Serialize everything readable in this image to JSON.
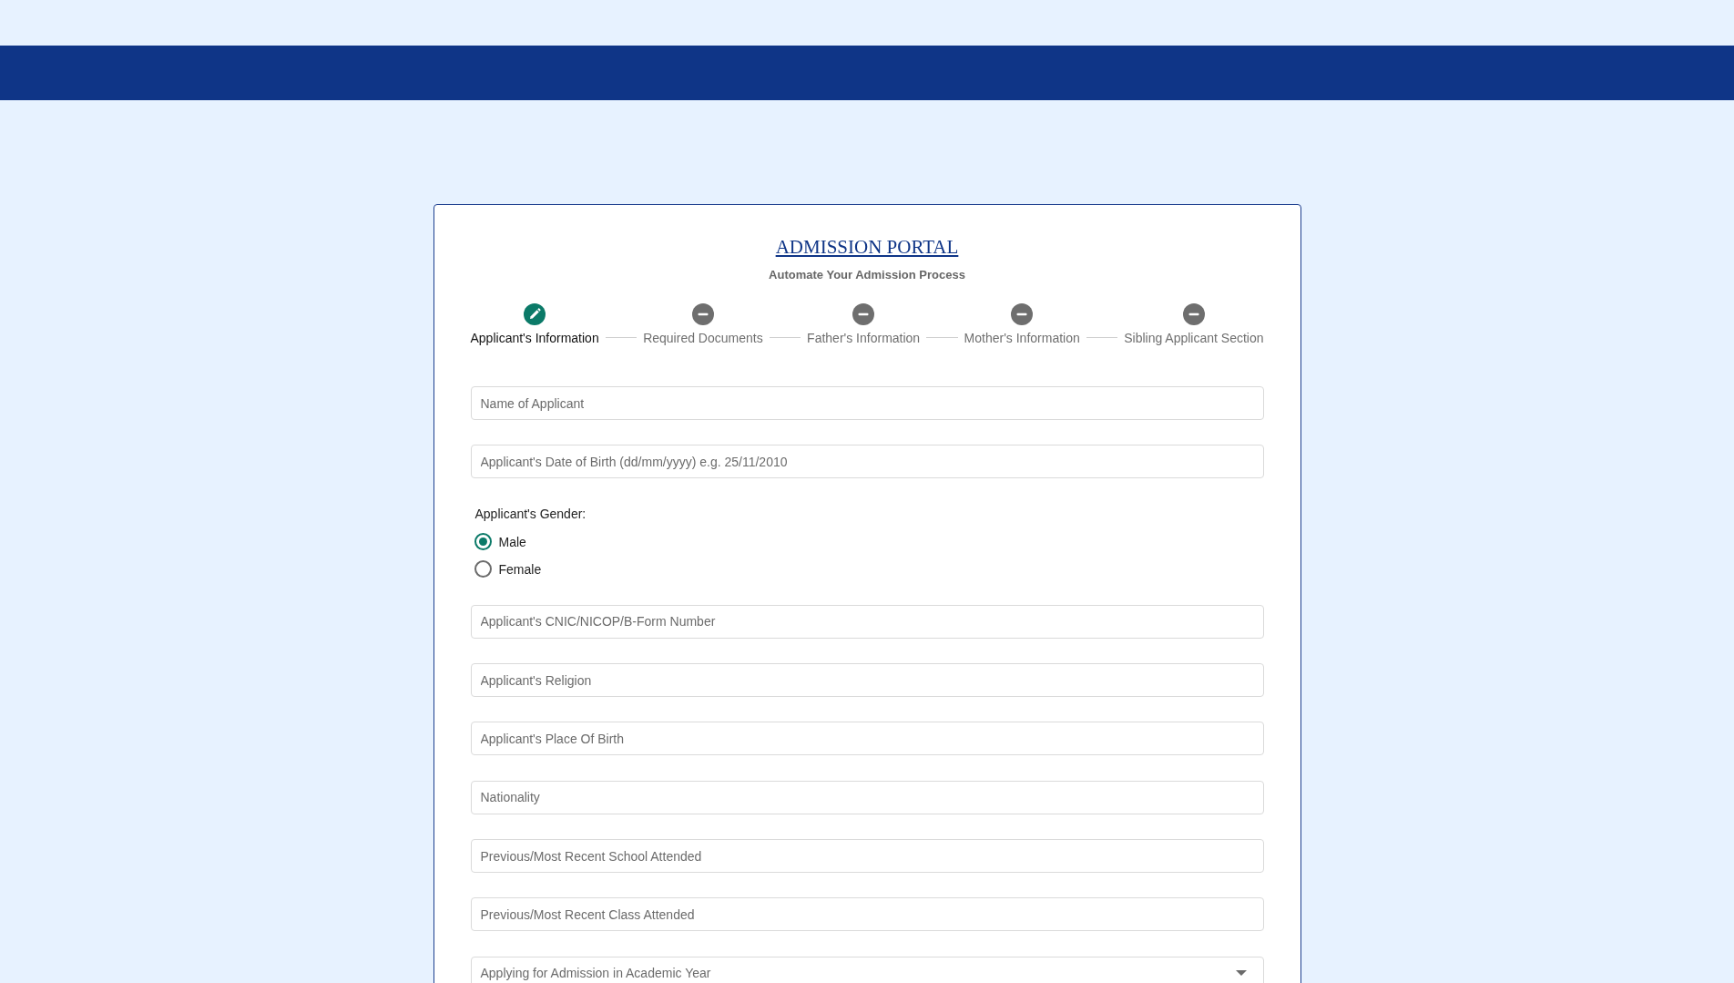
{
  "portal": {
    "title": "ADMISSION PORTAL",
    "subtitle": "Automate Your Admission Process"
  },
  "steps": [
    {
      "label": "Applicant's Information",
      "selected": true
    },
    {
      "label": "Required Documents",
      "selected": false
    },
    {
      "label": "Father's Information",
      "selected": false
    },
    {
      "label": "Mother's Information",
      "selected": false
    },
    {
      "label": "Sibling Applicant Section",
      "selected": false
    }
  ],
  "form": [
    {
      "kind": "text",
      "placeholder": "Name of Applicant"
    },
    {
      "kind": "text",
      "placeholder": "Applicant's Date of Birth (dd/mm/yyyy) e.g. 25/11/2010"
    },
    {
      "kind": "radio_group",
      "label": "Applicant's Gender:",
      "options": [
        {
          "label": "Male",
          "selected": true
        },
        {
          "label": "Female",
          "selected": false
        }
      ]
    },
    {
      "kind": "text",
      "placeholder": "Applicant's CNIC/NICOP/B-Form Number"
    },
    {
      "kind": "text",
      "placeholder": "Applicant's Religion"
    },
    {
      "kind": "text",
      "placeholder": "Applicant's Place Of Birth"
    },
    {
      "kind": "text",
      "placeholder": "Nationality"
    },
    {
      "kind": "text",
      "placeholder": "Previous/Most Recent School Attended"
    },
    {
      "kind": "text",
      "placeholder": "Previous/Most Recent Class Attended"
    },
    {
      "kind": "select",
      "placeholder": "Applying for Admission in Academic Year"
    }
  ]
}
